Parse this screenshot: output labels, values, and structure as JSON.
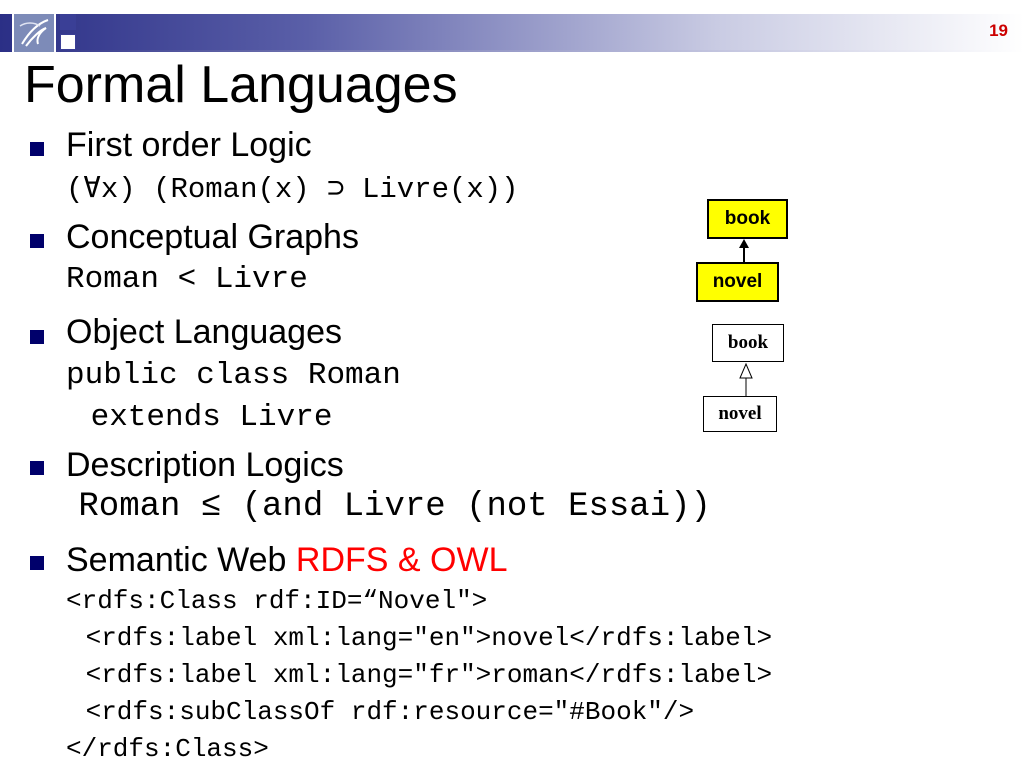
{
  "slide": {
    "number": "19",
    "title": "Formal Languages"
  },
  "items": [
    {
      "label": "First order Logic",
      "code": [
        "(∀x) (Roman(x) ⊃ Livre(x))"
      ]
    },
    {
      "label": "Conceptual Graphs",
      "code": [
        "Roman < Livre"
      ]
    },
    {
      "label": "Object Languages",
      "code": [
        "public class Roman",
        " extends Livre"
      ]
    },
    {
      "label": "Description Logics",
      "code": [
        " Roman ≤ (and Livre (not Essai))"
      ]
    },
    {
      "label": "Semantic Web ",
      "label_highlight": "RDFS & OWL",
      "code": [
        "<rdfs:Class rdf:ID=“Novel\">",
        " <rdfs:label xml:lang=\"en\">novel</rdfs:label>",
        " <rdfs:label xml:lang=\"fr\">roman</rdfs:label>",
        " <rdfs:subClassOf rdf:resource=\"#Book\"/>",
        "</rdfs:Class>"
      ]
    }
  ],
  "conceptual_graph": {
    "top": "book",
    "bottom": "novel"
  },
  "uml": {
    "top": "book",
    "bottom": "novel"
  },
  "colors": {
    "bullet": "#00006b",
    "highlight": "#ff0000",
    "slide_number": "#cc0000",
    "box_fill": "#ffff00"
  }
}
